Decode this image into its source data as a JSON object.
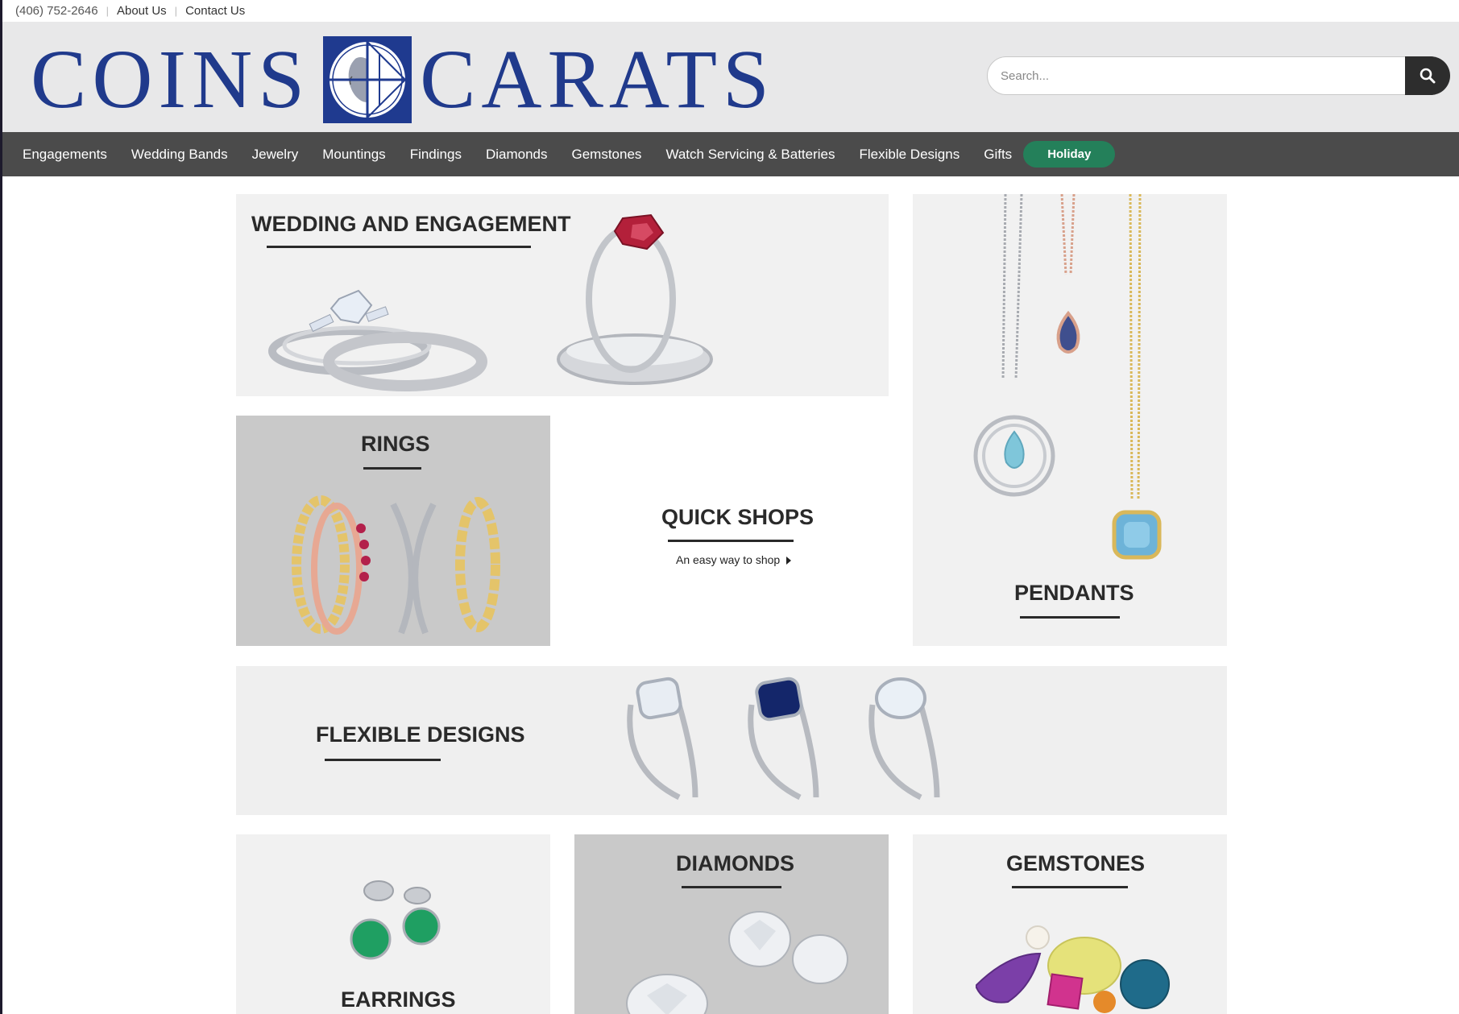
{
  "topbar": {
    "phone": "(406) 752-2646",
    "about": "About Us",
    "contact": "Contact Us"
  },
  "logo": {
    "word_left": "COINS",
    "word_right": "CARATS",
    "brand_color": "#203a8c"
  },
  "search": {
    "placeholder": "Search...",
    "icon": "search-icon"
  },
  "nav": {
    "items": [
      "Engagements",
      "Wedding Bands",
      "Jewelry",
      "Mountings",
      "Findings",
      "Diamonds",
      "Gemstones",
      "Watch Servicing & Batteries",
      "Flexible Designs",
      "Gifts"
    ],
    "holiday": "Holiday",
    "holiday_color": "#24805a"
  },
  "tiles": {
    "wedding": "WEDDING AND ENGAGEMENT",
    "rings": "RINGS",
    "quick_shops": "QUICK SHOPS",
    "quick_shops_sub": "An easy way to shop",
    "pendants": "PENDANTS",
    "flexible": "FLEXIBLE DESIGNS",
    "earrings": "EARRINGS",
    "diamonds": "DIAMONDS",
    "gemstones": "GEMSTONES"
  }
}
